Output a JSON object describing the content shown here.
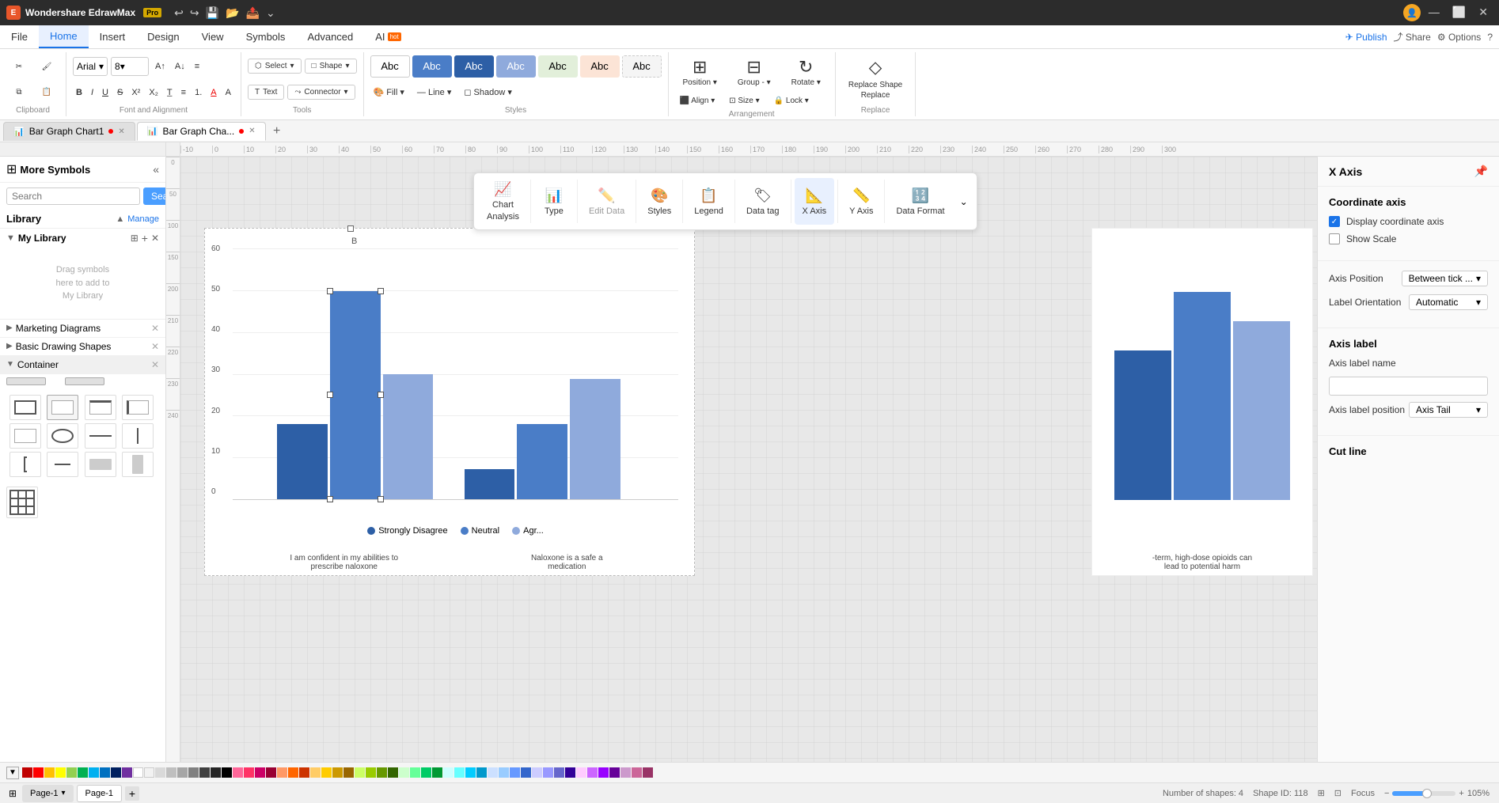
{
  "app": {
    "name": "Wondershare EdrawMax",
    "version": "Pro",
    "title": "Wondershare EdrawMax Pro"
  },
  "titlebar": {
    "undo_icon": "↩",
    "redo_icon": "↪",
    "save_icon": "💾",
    "open_icon": "📂",
    "export_icon": "📤",
    "min_btn": "—",
    "max_btn": "⬜",
    "close_btn": "✕"
  },
  "menu": {
    "items": [
      "File",
      "Home",
      "Insert",
      "Design",
      "View",
      "Symbols",
      "Advanced"
    ],
    "ai_label": "AI",
    "ai_badge": "hot",
    "active_index": 1,
    "publish_label": "Publish",
    "share_label": "Share",
    "options_label": "Options"
  },
  "ribbon": {
    "clipboard": {
      "label": "Clipboard",
      "cut": "✂",
      "copy": "⧉",
      "paste": "📋",
      "format_painter": "🖌"
    },
    "font": {
      "label": "Font and Alignment",
      "family": "Arial",
      "size": "8",
      "bold": "B",
      "italic": "I",
      "underline": "U",
      "strikethrough": "S",
      "superscript": "X²",
      "subscript": "X₂",
      "clear": "T",
      "list": "≡",
      "numbered": "1.",
      "font_color": "A",
      "fill_color": "A"
    },
    "tools": {
      "label": "Tools",
      "select": "Select",
      "shape": "Shape",
      "text": "Text",
      "connector": "Connector"
    },
    "styles": {
      "label": "Styles",
      "items": [
        {
          "label": "Abc",
          "style": 0
        },
        {
          "label": "Abc",
          "style": 1
        },
        {
          "label": "Abc",
          "style": 2
        },
        {
          "label": "Abc",
          "style": 3
        },
        {
          "label": "Abc",
          "style": 4
        },
        {
          "label": "Abc",
          "style": 5
        },
        {
          "label": "Abc",
          "style": 6
        }
      ],
      "fill": "Fill",
      "line": "Line",
      "shadow": "Shadow"
    },
    "arrangement": {
      "label": "Arrangement",
      "position": "Position",
      "group": "Group",
      "rotate": "Rotate",
      "align": "Align",
      "size": "Size",
      "lock": "Lock"
    },
    "replace": {
      "label": "Replace",
      "replace_shape": "Replace Shape",
      "replace": "Replace"
    }
  },
  "doc_tabs": [
    {
      "label": "Bar Graph Chart1",
      "active": false,
      "has_dot": true,
      "icon": "📊"
    },
    {
      "label": "Bar Graph Cha...",
      "active": true,
      "has_dot": true,
      "icon": "📊"
    }
  ],
  "left_panel": {
    "title": "More Symbols",
    "search_placeholder": "Search",
    "search_btn": "Search",
    "library_label": "Library",
    "manage_label": "Manage",
    "my_library_label": "My Library",
    "drag_hint": "Drag symbols\nhere to add to\nMy Library",
    "categories": [
      {
        "name": "Marketing Diagrams",
        "expanded": false
      },
      {
        "name": "Basic Drawing Shapes",
        "expanded": false
      },
      {
        "name": "Container",
        "expanded": true
      }
    ]
  },
  "chart_toolbar": {
    "items": [
      {
        "label": "Chart\nAnalysis",
        "icon": "📈"
      },
      {
        "label": "Type",
        "icon": "📊"
      },
      {
        "label": "Edit Data",
        "icon": "✏️"
      },
      {
        "label": "Styles",
        "icon": "🎨"
      },
      {
        "label": "Legend",
        "icon": "📋"
      },
      {
        "label": "Data tag",
        "icon": "🏷"
      },
      {
        "label": "X Axis",
        "icon": "📐"
      },
      {
        "label": "Y Axis",
        "icon": "📏"
      },
      {
        "label": "Data Format",
        "icon": "🔢"
      }
    ]
  },
  "chart": {
    "y_labels": [
      "0",
      "10",
      "20",
      "30",
      "40",
      "50",
      "60"
    ],
    "groups": [
      {
        "bars": [
          {
            "height_pct": 18,
            "type": "dark-blue"
          },
          {
            "height_pct": 50,
            "type": "medium-blue"
          },
          {
            "height_pct": 30,
            "type": "light-blue"
          }
        ]
      },
      {
        "bars": [
          {
            "height_pct": 7,
            "type": "dark-blue"
          },
          {
            "height_pct": 18,
            "type": "medium-blue"
          },
          {
            "height_pct": 29,
            "type": "light-blue"
          }
        ]
      }
    ],
    "legend": [
      {
        "label": "Strongly Disagree",
        "color": "#2d5fa6"
      },
      {
        "label": "Neutral",
        "color": "#4a7dc7"
      },
      {
        "label": "Agr...",
        "color": "#8faadc"
      }
    ],
    "x_labels": [
      "I am confident in my abilities to\nprescribe naloxone",
      "Naloxone is a safe a\nmedication"
    ],
    "partial_x_label": "-term, high-dose opioids can\nlead to potential harm"
  },
  "xaxis_panel": {
    "title": "X Axis",
    "coordinate_axis": {
      "section_title": "Coordinate axis",
      "display_coord": "Display coordinate axis",
      "show_scale": "Show Scale",
      "display_coord_checked": true,
      "show_scale_checked": false
    },
    "axis_position": {
      "label": "Axis Position",
      "value": "Between tick ..."
    },
    "label_orientation": {
      "label": "Label Orientation",
      "value": "Automatic"
    },
    "axis_label": {
      "section_title": "Axis label",
      "label_name": "Axis label name",
      "label_position": "Axis label position",
      "label_position_value": "Axis Tail"
    },
    "cut_line": {
      "title": "Cut line"
    }
  },
  "status_bar": {
    "shapes_count": "Number of shapes: 4",
    "shape_id": "Shape ID: 118",
    "zoom_level": "105%",
    "page_label": "Page-1",
    "focus_label": "Focus"
  },
  "page_tabs": [
    {
      "label": "Page-1",
      "active": false
    },
    {
      "label": "Page-1",
      "active": true
    }
  ],
  "color_palette": [
    "#c00000",
    "#ff0000",
    "#ffc000",
    "#ffff00",
    "#92d050",
    "#00b050",
    "#00b0f0",
    "#0070c0",
    "#002060",
    "#7030a0",
    "#ffffff",
    "#000000",
    "#808080",
    "#c0c0c0",
    "#f2f2f2",
    "#dce6f1",
    "#fce4d6",
    "#fff2cc",
    "#e2efda",
    "#ddebf7",
    "#ffd7d7",
    "#ff9933",
    "#ffcc00",
    "#99cc00",
    "#66ccff",
    "#3399ff",
    "#cc99ff",
    "#ff66cc",
    "#ff3399",
    "#cc0066",
    "#6600cc",
    "#0033cc",
    "#003399",
    "#336699",
    "#99ccff",
    "#ccffcc",
    "#ffffcc",
    "#ffcccc",
    "#cc6699",
    "#996699",
    "#663399",
    "#330099",
    "#003366",
    "#336699",
    "#669999",
    "#99cc99",
    "#cccc99",
    "#cc9966",
    "#996633",
    "#663300",
    "#330000",
    "#000033",
    "#003300",
    "#330033",
    "#333300",
    "#003333",
    "#333333",
    "#666666",
    "#999999",
    "#cccccc"
  ]
}
